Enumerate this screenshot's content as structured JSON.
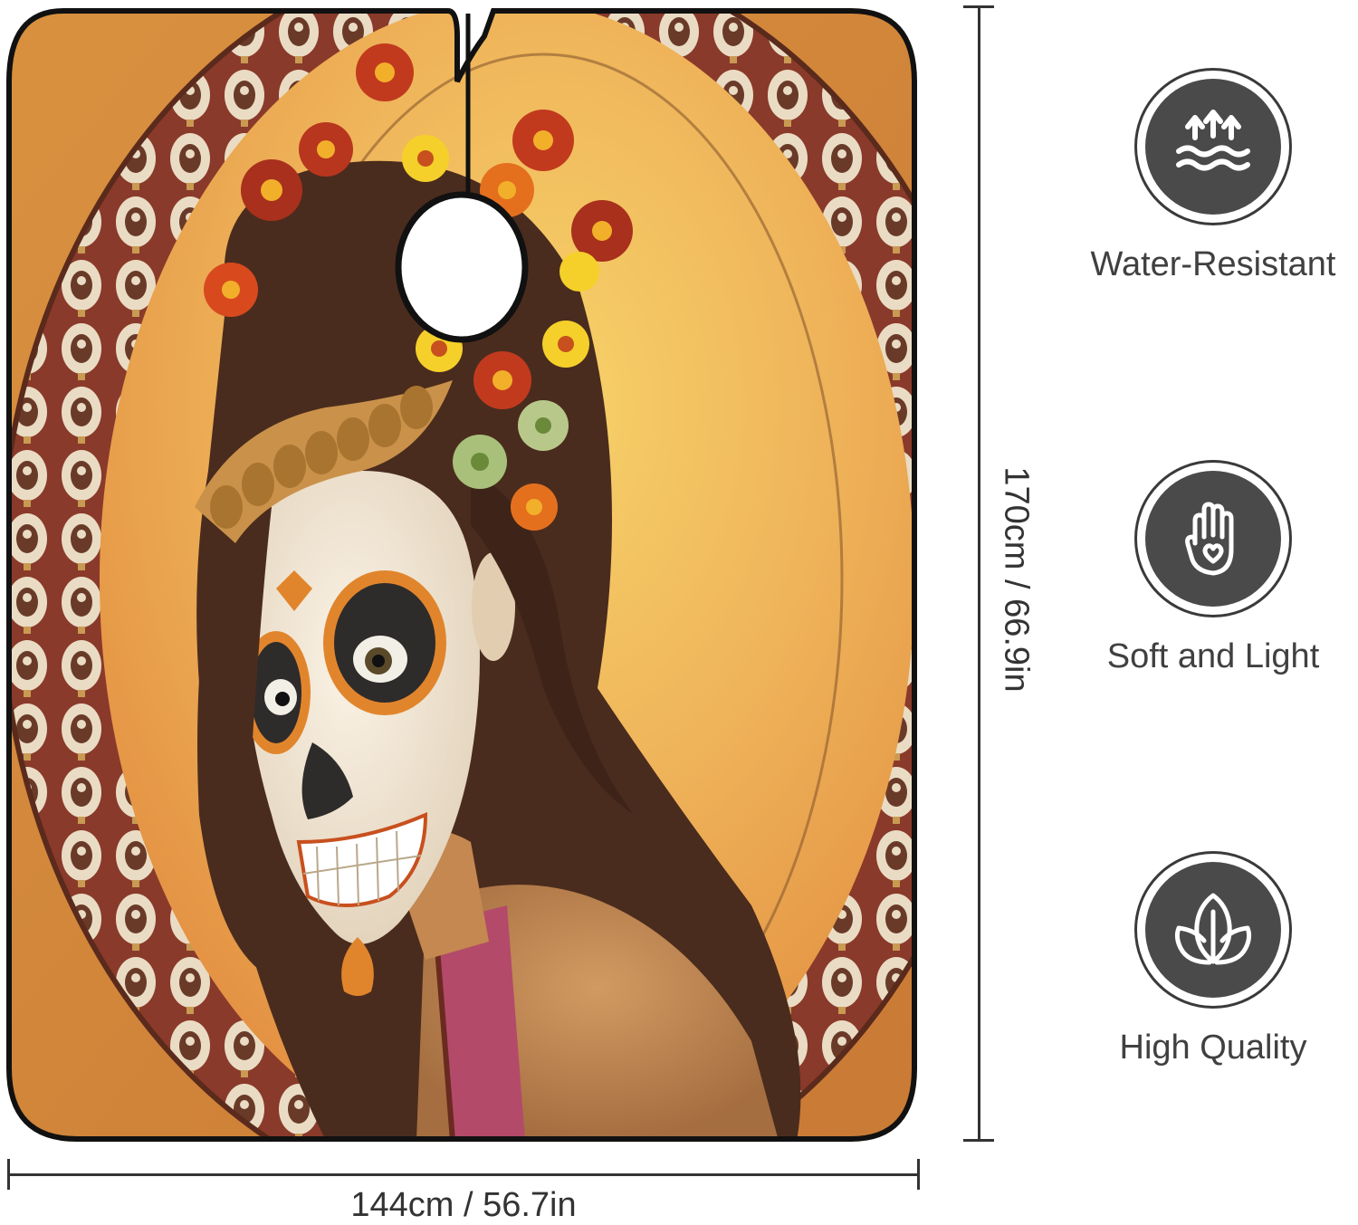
{
  "product": {
    "image_alt": "sugar skull woman barber cape"
  },
  "dimensions": {
    "width": "144cm / 56.7in",
    "height": "170cm / 66.9in"
  },
  "features": [
    {
      "icon": "water-resistant-icon",
      "label": "Water-Resistant"
    },
    {
      "icon": "hand-heart-icon",
      "label": "Soft and Light"
    },
    {
      "icon": "leaves-icon",
      "label": "High Quality"
    }
  ],
  "colors": {
    "cape_border": "#111111",
    "background_orange": "#e89a48",
    "ring_red": "#7a2f22",
    "icon_fill": "#4a4a4a",
    "text": "#404040"
  }
}
